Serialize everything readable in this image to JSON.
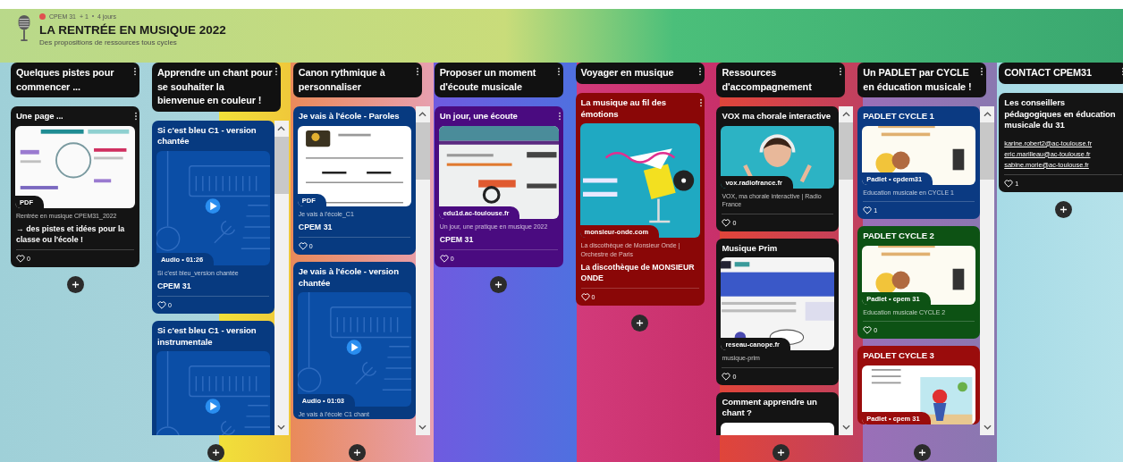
{
  "board": {
    "author": "CPEM 31",
    "contributors": "+ 1",
    "age": "4 jours",
    "title": "LA RENTRÉE EN MUSIQUE 2022",
    "subtitle": "Des propositions de ressources tous cycles"
  },
  "columns": [
    {
      "title": "Quelques pistes pour commencer ...",
      "scrollable": false,
      "posts": [
        {
          "title": "Une page ...",
          "color": "#141414",
          "attachment": {
            "kind": "pdf",
            "label": "PDF"
          },
          "caption": "Rentrée en musique CPEM31_2022",
          "body": "→ des pistes et idées pour la classe ou l'école !",
          "likes": "0"
        }
      ]
    },
    {
      "title": "Apprendre un chant pour se souhaiter la bienvenue en couleur !",
      "scrollable": true,
      "posts": [
        {
          "title": "Si c'est bleu C1 - version chantée",
          "color": "#073a80",
          "attachment": {
            "kind": "audio",
            "label": "Audio • 01:26"
          },
          "caption": "Si c'est bleu_version chantée",
          "body": "CPEM 31",
          "likes": "0"
        },
        {
          "title": "Si c'est bleu C1 - version instrumentale",
          "color": "#073a80",
          "attachment": {
            "kind": "audio"
          }
        }
      ]
    },
    {
      "title": "Canon rythmique à personnaliser",
      "scrollable": true,
      "posts": [
        {
          "title": "Je vais à l'école - Paroles",
          "color": "#073a80",
          "attachment": {
            "kind": "pdf",
            "label": "PDF"
          },
          "caption": "Je vais à l'école_C1",
          "body": "CPEM 31",
          "likes": "0"
        },
        {
          "title": "Je vais à l'école - version chantée",
          "color": "#073a80",
          "attachment": {
            "kind": "audio",
            "label": "Audio • 01:03"
          },
          "caption": "Je vais à l'école C1 chant"
        }
      ]
    },
    {
      "title": "Proposer un moment d'écoute musicale",
      "scrollable": false,
      "posts": [
        {
          "title": "Un jour, une écoute",
          "color": "#4a0b80",
          "attachment": {
            "kind": "link",
            "label": "edu1d.ac-toulouse.fr"
          },
          "caption": "Un jour, une pratique en musique 2022",
          "body": "CPEM 31",
          "likes": "0"
        }
      ]
    },
    {
      "title": "Voyager en musique",
      "scrollable": false,
      "posts": [
        {
          "title": "La musique au fil des émotions",
          "color": "#8a0707",
          "attachment": {
            "kind": "link",
            "label": "monsieur-onde.com"
          },
          "caption": "La discothèque de Monsieur Onde | Orchestre de Paris",
          "body": "La discothèque de MONSIEUR ONDE",
          "likes": "0"
        }
      ]
    },
    {
      "title": "Ressources d'accompagnement",
      "scrollable": true,
      "posts": [
        {
          "title": "VOX ma chorale interactive",
          "color": "#141414",
          "attachment": {
            "kind": "link",
            "label": "vox.radiofrance.fr"
          },
          "caption": "VOX, ma chorale interactive | Radio France",
          "likes": "0"
        },
        {
          "title": "Musique Prim",
          "color": "#141414",
          "attachment": {
            "kind": "link",
            "label": "reseau-canope.fr"
          },
          "caption": "musique-prim",
          "likes": "0"
        },
        {
          "title": "Comment apprendre un chant ?",
          "color": "#141414",
          "attachment": {
            "kind": "link"
          }
        }
      ]
    },
    {
      "title": "Un PADLET par CYCLE en éducation musicale !",
      "scrollable": true,
      "posts": [
        {
          "title": "PADLET CYCLE 1",
          "color": "#0b3a82",
          "attachment": {
            "kind": "link",
            "label": "Padlet • cpdem31"
          },
          "caption": "Education musicale en CYCLE 1",
          "likes": "1"
        },
        {
          "title": "PADLET CYCLE 2",
          "color": "#0d5214",
          "attachment": {
            "kind": "link",
            "label": "Padlet • cpem 31"
          },
          "caption": "Education musicale CYCLE 2",
          "likes": "0"
        },
        {
          "title": "PADLET CYCLE 3",
          "color": "#9a0c0c",
          "attachment": {
            "kind": "link",
            "label": "Padlet • cpem 31"
          }
        }
      ]
    },
    {
      "title": "CONTACT CPEM31",
      "scrollable": false,
      "posts": [
        {
          "title": "Les conseillers pédagogiques en éducation musicale du 31",
          "color": "#141414",
          "links": [
            "karine.robert2@ac-toulouse.fr",
            "eric.marilleau@ac-toulouse.fr",
            "sabine.morie@ac-toulouse.fr"
          ],
          "likes": "1"
        }
      ]
    }
  ]
}
